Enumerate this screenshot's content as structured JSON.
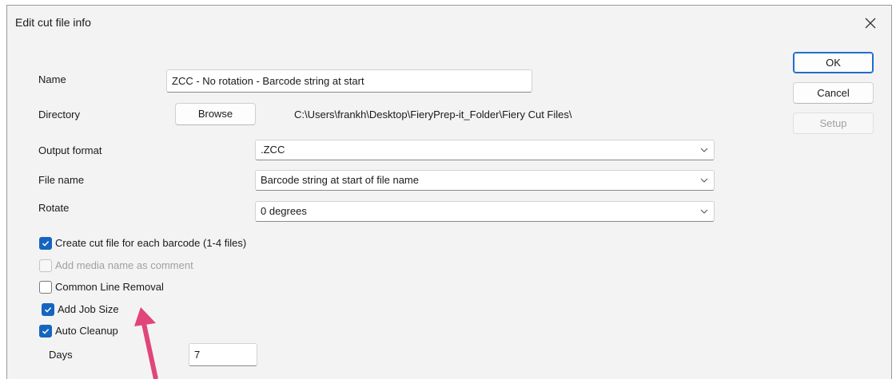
{
  "window": {
    "title": "Edit cut file info",
    "close_icon": "close-icon"
  },
  "form": {
    "name": {
      "label": "Name",
      "value": "ZCC - No rotation - Barcode string at start"
    },
    "directory": {
      "label": "Directory",
      "browse_label": "Browse",
      "path": "C:\\Users\\frankh\\Desktop\\FieryPrep-it_Folder\\Fiery Cut Files\\"
    },
    "output_format": {
      "label": "Output format",
      "value": ".ZCC"
    },
    "file_name": {
      "label": "File name",
      "value": "Barcode string at start of file name"
    },
    "rotate": {
      "label": "Rotate",
      "value": "0 degrees"
    }
  },
  "options": [
    {
      "label": "Create cut file for each barcode (1-4 files)",
      "checked": true,
      "disabled": false
    },
    {
      "label": "Add media name as comment",
      "checked": false,
      "disabled": true
    },
    {
      "label": "Common Line Removal",
      "checked": false,
      "disabled": false
    },
    {
      "label": "Add Job Size",
      "checked": true,
      "disabled": false
    },
    {
      "label": "Auto Cleanup",
      "checked": true,
      "disabled": false
    }
  ],
  "days": {
    "label": "Days",
    "value": "7"
  },
  "buttons": {
    "ok": "OK",
    "cancel": "Cancel",
    "setup": "Setup"
  },
  "colors": {
    "accent": "#1565c0",
    "annotation_arrow": "#e0457b"
  }
}
